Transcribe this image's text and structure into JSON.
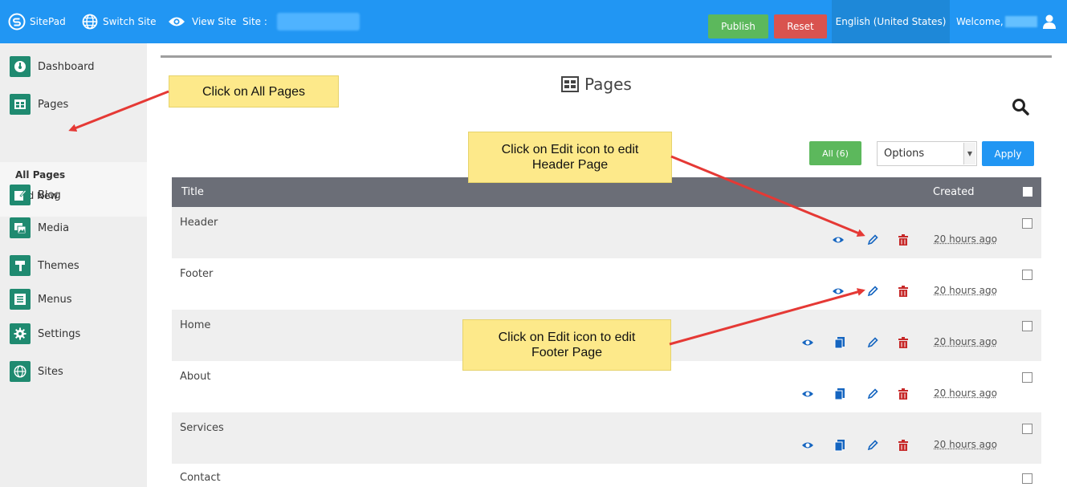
{
  "topbar": {
    "sitepad_label": "SitePad",
    "switch_site_label": "Switch Site",
    "view_site_label": "View Site",
    "site_label": "Site :",
    "publish_label": "Publish",
    "reset_label": "Reset",
    "language_label": "English (United States)",
    "welcome_label": "Welcome,"
  },
  "sidebar": {
    "items": [
      {
        "label": "Dashboard",
        "icon": "dashboard-icon"
      },
      {
        "label": "Pages",
        "icon": "pages-icon"
      },
      {
        "label": "Blog",
        "icon": "blog-icon"
      },
      {
        "label": "Media",
        "icon": "media-icon"
      },
      {
        "label": "Themes",
        "icon": "themes-icon"
      },
      {
        "label": "Menus",
        "icon": "menus-icon"
      },
      {
        "label": "Settings",
        "icon": "settings-icon"
      },
      {
        "label": "Sites",
        "icon": "sites-icon"
      }
    ],
    "subitems": [
      "All Pages",
      "Add New"
    ]
  },
  "main": {
    "title": "Pages",
    "filter_all_label": "All (6)",
    "options_value": "Options",
    "apply_label": "Apply",
    "table": {
      "col_title": "Title",
      "col_created": "Created",
      "rows": [
        {
          "title": "Header",
          "created": "20 hours ago"
        },
        {
          "title": "Footer",
          "created": "20 hours ago"
        },
        {
          "title": "Home",
          "created": "20 hours ago"
        },
        {
          "title": "About",
          "created": "20 hours ago"
        },
        {
          "title": "Services",
          "created": "20 hours ago"
        },
        {
          "title": "Contact",
          "created": ""
        }
      ]
    }
  },
  "callouts": {
    "all_pages": "Click on All Pages",
    "edit_header_line1": "Click on Edit icon to edit",
    "edit_header_line2": "Header Page",
    "edit_footer_line1": "Click on Edit icon to edit",
    "edit_footer_line2": "Footer Page"
  },
  "colors": {
    "topbar": "#2196f3",
    "publish": "#5cb85c",
    "reset": "#d9534f",
    "sidebar_icon": "#1f8a70",
    "table_header": "#6b6e77",
    "delete_icon": "#c62828",
    "action_icon": "#1565c0",
    "callout": "#fde98a",
    "arrow": "#e53935"
  }
}
